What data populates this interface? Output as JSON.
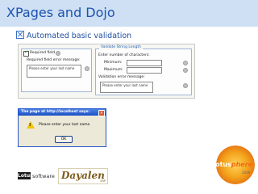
{
  "title": "XPages and Dojo",
  "bullet": "Automated basic validation",
  "form": {
    "required_checkbox_label": "Required field",
    "required_error_label": "Required field error message:",
    "required_error_value": "Please enter your last name",
    "legend": "Validate String Length",
    "enter_label": "Enter number of characters:",
    "minimum_label": "Minimum:",
    "maximum_label": "Maximum:",
    "validation_error_label": "Validation error message:",
    "validation_error_value": "Please enter your last name"
  },
  "dialog": {
    "title": "The page at http://localhost says:",
    "message": "Please enter your last name",
    "ok_label": "OK"
  },
  "footer": {
    "lotus": "Lotus",
    "software": "software",
    "dayalen": "Dayalen",
    "dayalen_sub": "SRP",
    "lotusphere_a": "Lotus",
    "lotusphere_b": "phere",
    "lotusphere_year": "2009"
  }
}
